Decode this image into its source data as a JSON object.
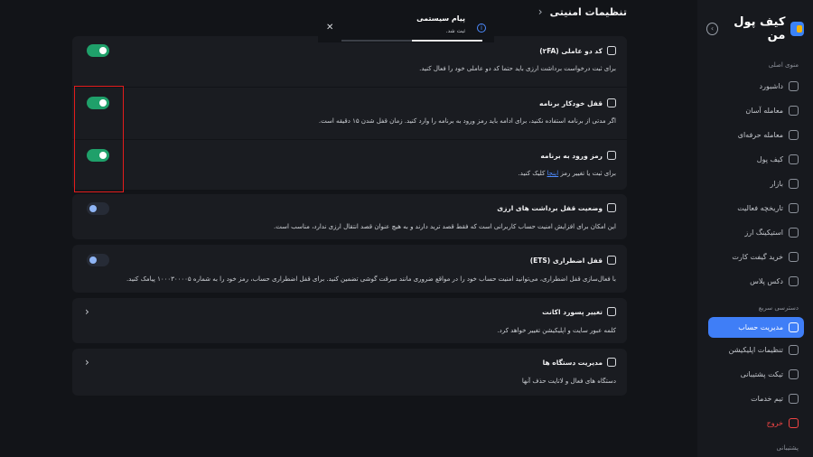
{
  "header": {
    "title": "تنظیمات امنیتی",
    "back_icon": "chevron-right-icon"
  },
  "toast": {
    "title": "پیام سیستمی",
    "subtitle": "ثبت شد.",
    "progress": 0.5,
    "close_icon": "close-icon",
    "info_icon": "info-icon"
  },
  "sidebar": {
    "brand": "کیف پول من",
    "collapse_icon": "collapse-arrow-icon",
    "section_main": "منوی اصلی",
    "items": [
      {
        "label": "داشبورد",
        "icon": "dashboard-icon"
      },
      {
        "label": "معامله آسان",
        "icon": "easy-trade-icon"
      },
      {
        "label": "معامله حرفه‌ای",
        "icon": "pro-trade-icon"
      },
      {
        "label": "کیف پول",
        "icon": "wallet-icon"
      },
      {
        "label": "بازار",
        "icon": "market-icon"
      },
      {
        "label": "تاریخچه فعالیت",
        "icon": "history-icon"
      },
      {
        "label": "استیکینگ ارز",
        "icon": "staking-icon"
      },
      {
        "label": "خرید گیفت کارت",
        "icon": "gift-card-icon"
      },
      {
        "label": "دکس پلاس",
        "icon": "dex-plus-icon"
      }
    ],
    "section_quick": "دسترسی سریع",
    "quick_items": [
      {
        "label": "مدیریت حساب",
        "icon": "account-icon",
        "active": true
      },
      {
        "label": "تنظیمات اپلیکیشن",
        "icon": "settings-icon"
      },
      {
        "label": "تیکت پشتیبانی",
        "icon": "ticket-icon"
      },
      {
        "label": "تیم خدمات",
        "icon": "team-icon"
      }
    ],
    "logout": "خروج",
    "section_support": "پشتیبانی"
  },
  "settings": [
    {
      "title": "کد دو عاملی (۲FA)",
      "desc": "برای ثبت درخواست برداشت ارزی باید حتما کد دو عاملی خود را فعال کنید.",
      "icon": "grid-icon",
      "toggle": true
    },
    {
      "title": "قفل خودکار برنامه",
      "desc": "اگر مدتی از برنامه استفاده نکنید، برای ادامه باید رمز ورود به برنامه را وارد کنید. زمان قفل شدن ۱۵ دقیقه است.",
      "icon": "lock-icon",
      "toggle": true
    },
    {
      "title": "رمز ورود به برنامه",
      "desc_before": "برای ثبت یا تغییر رمز",
      "desc_link": "اینجا",
      "desc_after": "کلیک کنید.",
      "icon": "key-icon",
      "toggle": true
    },
    {
      "title": "وضعیت قفل برداشت های ارزی",
      "desc": "این امکان برای افزایش امنیت حساب کاربرانی است که فقط قصد ترید دارند و به هیچ عنوان قصد انتقال ارزی ندارد، مناسب است.",
      "icon": "lock-icon",
      "toggle": false
    },
    {
      "title": "قفل اضطراری (ETS)",
      "desc": "با فعال‌سازی قفل اضطراری، می‌توانید امنیت حساب خود را در مواقع ضروری مانند سرقت گوشی تضمین کنید. برای قفل اضطراری حساب، رمز خود را به شماره ۱۰۰۰۳۰۰۰۰۵ پیامک کنید.",
      "icon": "lock-icon",
      "toggle": false
    },
    {
      "title": "تغییر پسورد اکانت",
      "desc": "کلمه عبور سایت و اپلیکیشن تغییر خواهد کرد.",
      "icon": "password-icon",
      "chevron_icon": "chevron-left-icon"
    },
    {
      "title": "مدیریت دستگاه ها",
      "desc": "دستگاه های فعال و لاتایت حذف آنها",
      "icon": "device-icon",
      "chevron_icon": "chevron-left-icon"
    }
  ]
}
